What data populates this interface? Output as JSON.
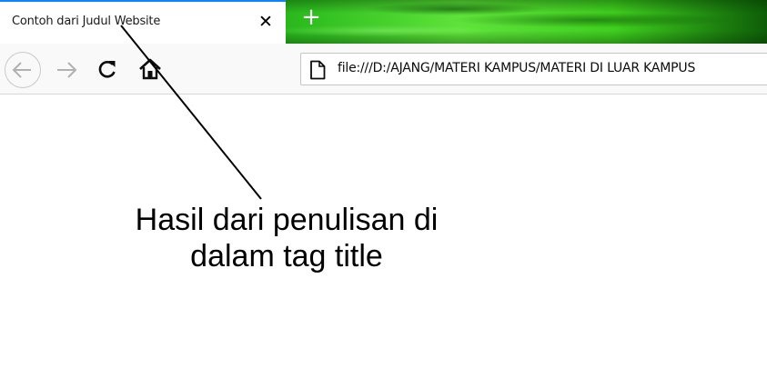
{
  "browser": {
    "tab": {
      "title": "Contoh dari Judul Website",
      "close_icon": "close-icon",
      "close_glyph": "✕"
    },
    "new_tab_glyph": "+",
    "nav": {
      "back_icon": "arrow-left-icon",
      "forward_icon": "arrow-right-icon",
      "reload_icon": "reload-icon",
      "home_icon": "home-icon"
    },
    "urlbar": {
      "icon": "page-icon",
      "url": "file:///D:/AJANG/MATERI KAMPUS/MATERI DI LUAR KAMPUS"
    }
  },
  "annotation": {
    "line1": "Hasil dari penulisan di",
    "line2": "dalam tag title"
  },
  "colors": {
    "tab_accent": "#0a84ff",
    "tabstrip_theme": "#2ebd1f",
    "toolbar_bg": "#f9f9fa"
  }
}
